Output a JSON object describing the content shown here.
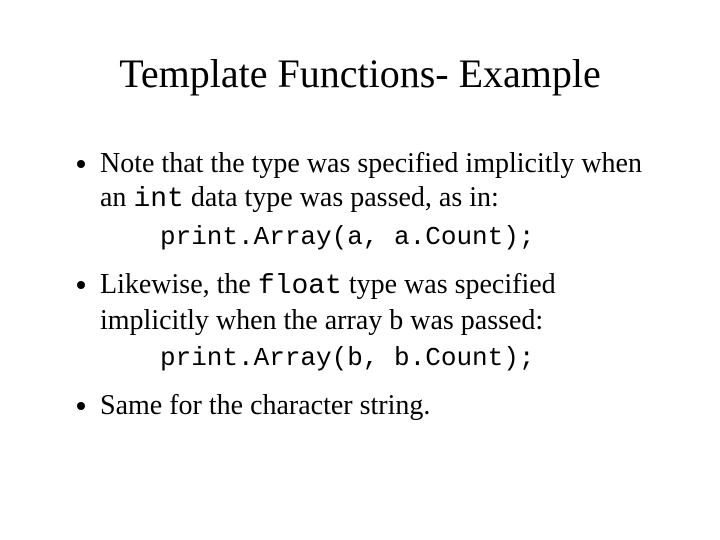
{
  "title": "Template Functions- Example",
  "bullet1_a": "Note that the type was specified implicitly when an ",
  "bullet1_code": "int",
  "bullet1_b": " data type was passed, as in:",
  "code1": "print.Array(a, a.Count);",
  "bullet2_a": "Likewise, the ",
  "bullet2_code": "float",
  "bullet2_b": " type was specified implicitly when the array b was passed:",
  "code2": "print.Array(b, b.Count);",
  "bullet3": "Same for the character string."
}
